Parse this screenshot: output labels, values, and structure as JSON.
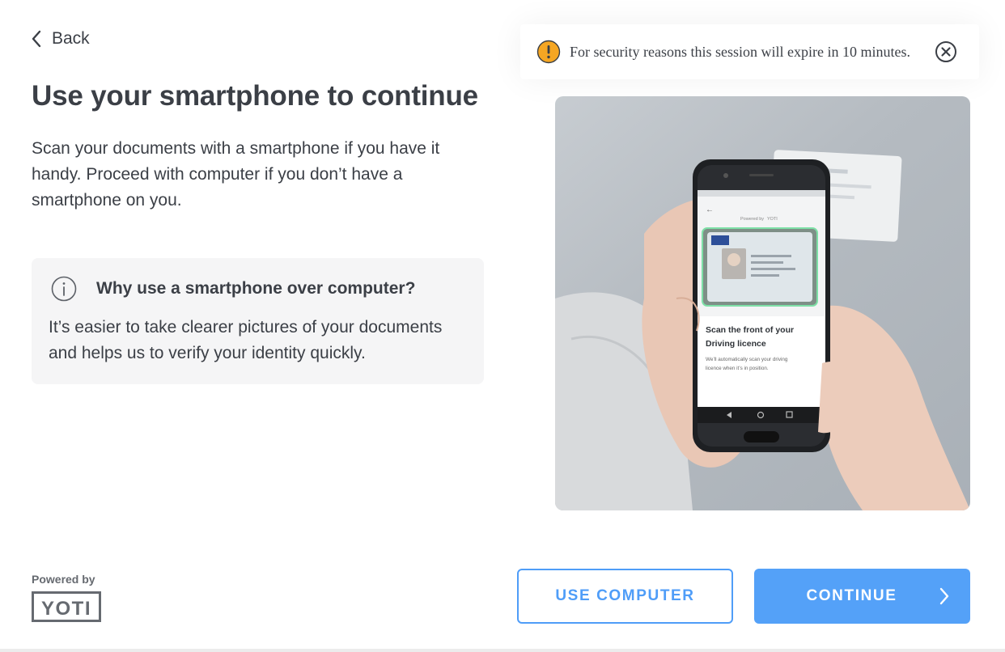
{
  "nav": {
    "back_label": "Back"
  },
  "page": {
    "title": "Use your smartphone to continue",
    "description": "Scan your documents with a smartphone if you have it handy. Proceed with computer if you don’t have a smartphone on you."
  },
  "info_box": {
    "title": "Why use a smartphone over computer?",
    "text": "It’s easier to take clearer pictures of your documents and helps us to verify your identity quickly."
  },
  "session_banner": {
    "message": "For security reasons this session will expire in 10 minutes."
  },
  "illustration": {
    "phone_powered_by": "Powered by",
    "phone_brand": "YOTI",
    "phone_scan_title_line1": "Scan the front of your",
    "phone_scan_title_line2": "Driving licence",
    "phone_scan_sub_line1": "We’ll automatically scan your driving",
    "phone_scan_sub_line2": "licence when it’s in position."
  },
  "buttons": {
    "use_computer": "USE COMPUTER",
    "continue": "CONTINUE"
  },
  "footer": {
    "powered_by": "Powered by",
    "logo_text": "YOTI"
  },
  "colors": {
    "accent": "#54a1f8",
    "warning": "#f5a623",
    "text": "#3b3f46",
    "info_bg": "#f5f5f6"
  }
}
